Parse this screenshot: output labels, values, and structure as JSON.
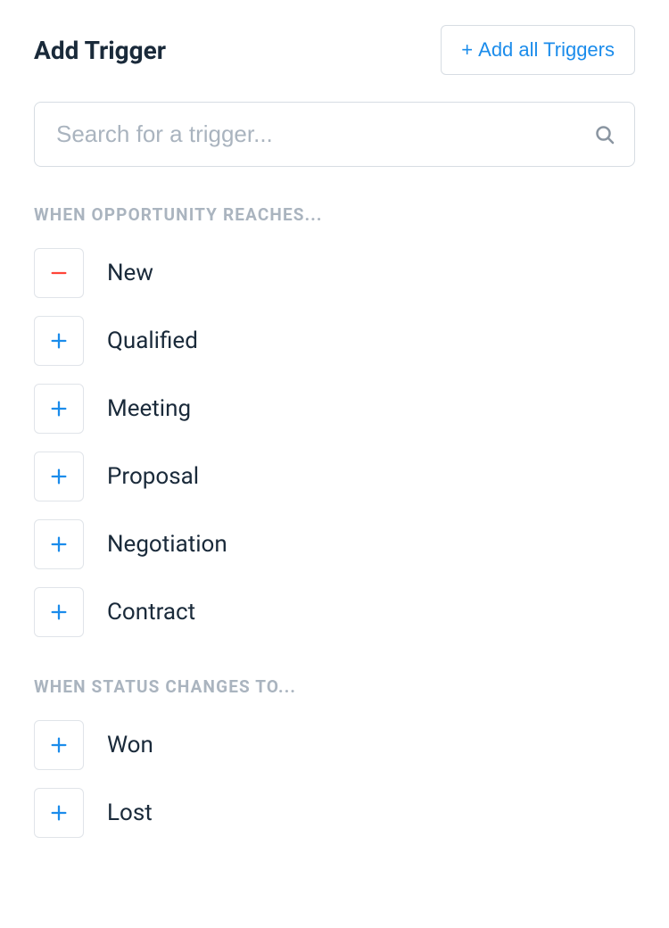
{
  "header": {
    "title": "Add Trigger",
    "add_all_label": "Add all Triggers"
  },
  "search": {
    "placeholder": "Search for a trigger...",
    "value": ""
  },
  "sections": {
    "opportunity": {
      "label": "When opportunity reaches...",
      "items": [
        {
          "label": "New",
          "state": "remove"
        },
        {
          "label": "Qualified",
          "state": "add"
        },
        {
          "label": "Meeting",
          "state": "add"
        },
        {
          "label": "Proposal",
          "state": "add"
        },
        {
          "label": "Negotiation",
          "state": "add"
        },
        {
          "label": "Contract",
          "state": "add"
        }
      ]
    },
    "status": {
      "label": "When status changes to...",
      "items": [
        {
          "label": "Won",
          "state": "add"
        },
        {
          "label": "Lost",
          "state": "add"
        }
      ]
    }
  }
}
